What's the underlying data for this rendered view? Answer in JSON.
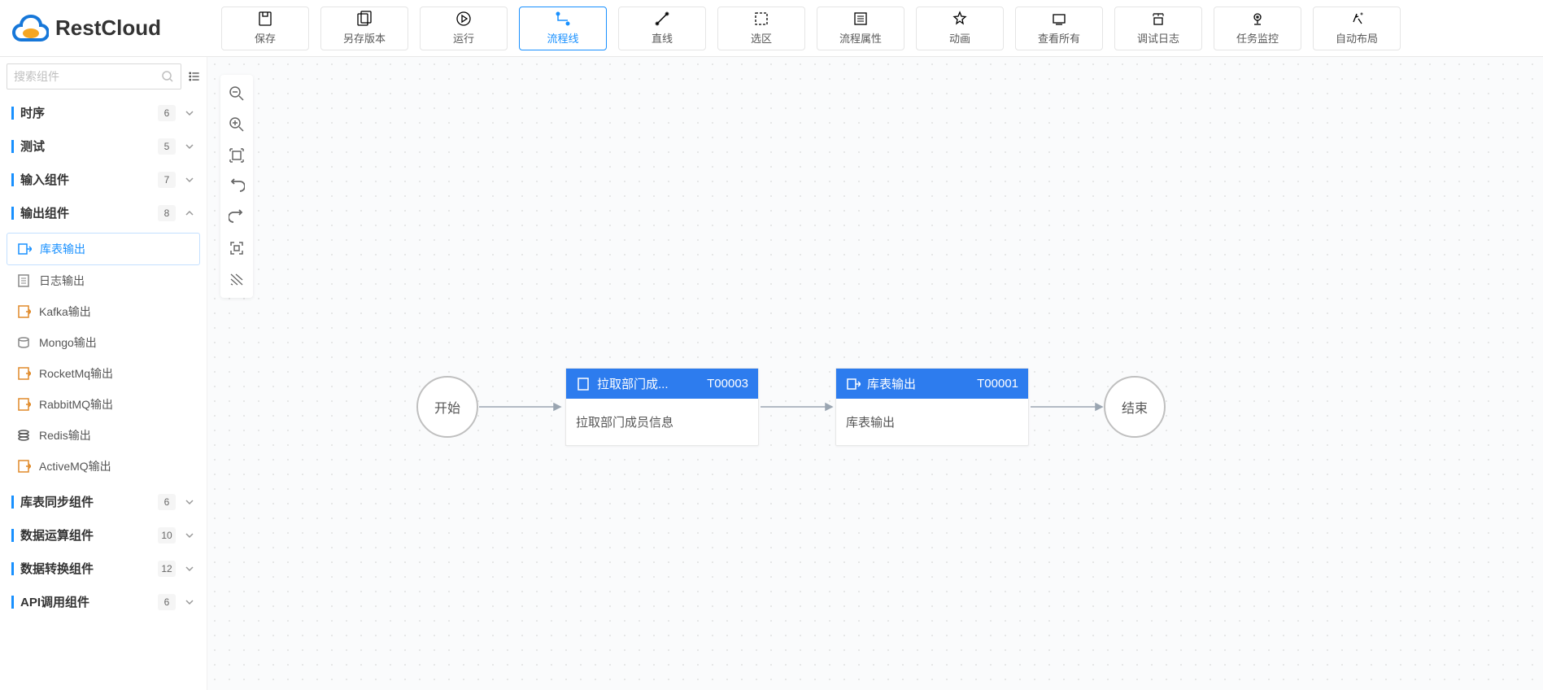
{
  "logo_text": "RestCloud",
  "toolbar": [
    {
      "id": "save",
      "label": "保存"
    },
    {
      "id": "save-as",
      "label": "另存版本"
    },
    {
      "id": "run",
      "label": "运行"
    },
    {
      "id": "flowline",
      "label": "流程线",
      "active": true
    },
    {
      "id": "straight",
      "label": "直线"
    },
    {
      "id": "selection",
      "label": "选区"
    },
    {
      "id": "flow-props",
      "label": "流程属性"
    },
    {
      "id": "animation",
      "label": "动画"
    },
    {
      "id": "view-all",
      "label": "查看所有"
    },
    {
      "id": "debug-log",
      "label": "调试日志"
    },
    {
      "id": "task-monitor",
      "label": "任务监控"
    },
    {
      "id": "auto-layout",
      "label": "自动布局"
    }
  ],
  "search": {
    "placeholder": "搜索组件"
  },
  "sidebar": [
    {
      "title": "时序",
      "count": "6",
      "expanded": false
    },
    {
      "title": "测试",
      "count": "5",
      "expanded": false
    },
    {
      "title": "输入组件",
      "count": "7",
      "expanded": false
    },
    {
      "title": "输出组件",
      "count": "8",
      "expanded": true,
      "items": [
        {
          "label": "库表输出",
          "selected": true,
          "icon": "table-out"
        },
        {
          "label": "日志输出",
          "icon": "log"
        },
        {
          "label": "Kafka输出",
          "icon": "kafka"
        },
        {
          "label": "Mongo输出",
          "icon": "mongo"
        },
        {
          "label": "RocketMq输出",
          "icon": "rocketmq"
        },
        {
          "label": "RabbitMQ输出",
          "icon": "rabbitmq"
        },
        {
          "label": "Redis输出",
          "icon": "redis"
        },
        {
          "label": "ActiveMQ输出",
          "icon": "activemq"
        }
      ]
    },
    {
      "title": "库表同步组件",
      "count": "6",
      "expanded": false
    },
    {
      "title": "数据运算组件",
      "count": "10",
      "expanded": false
    },
    {
      "title": "数据转换组件",
      "count": "12",
      "expanded": false
    },
    {
      "title": "API调用组件",
      "count": "6",
      "expanded": false
    }
  ],
  "flow": {
    "start": "开始",
    "end": "结束",
    "nodes": [
      {
        "title": "拉取部门成...",
        "code": "T00003",
        "body": "拉取部门成员信息"
      },
      {
        "title": "库表输出",
        "code": "T00001",
        "body": "库表输出"
      }
    ]
  }
}
